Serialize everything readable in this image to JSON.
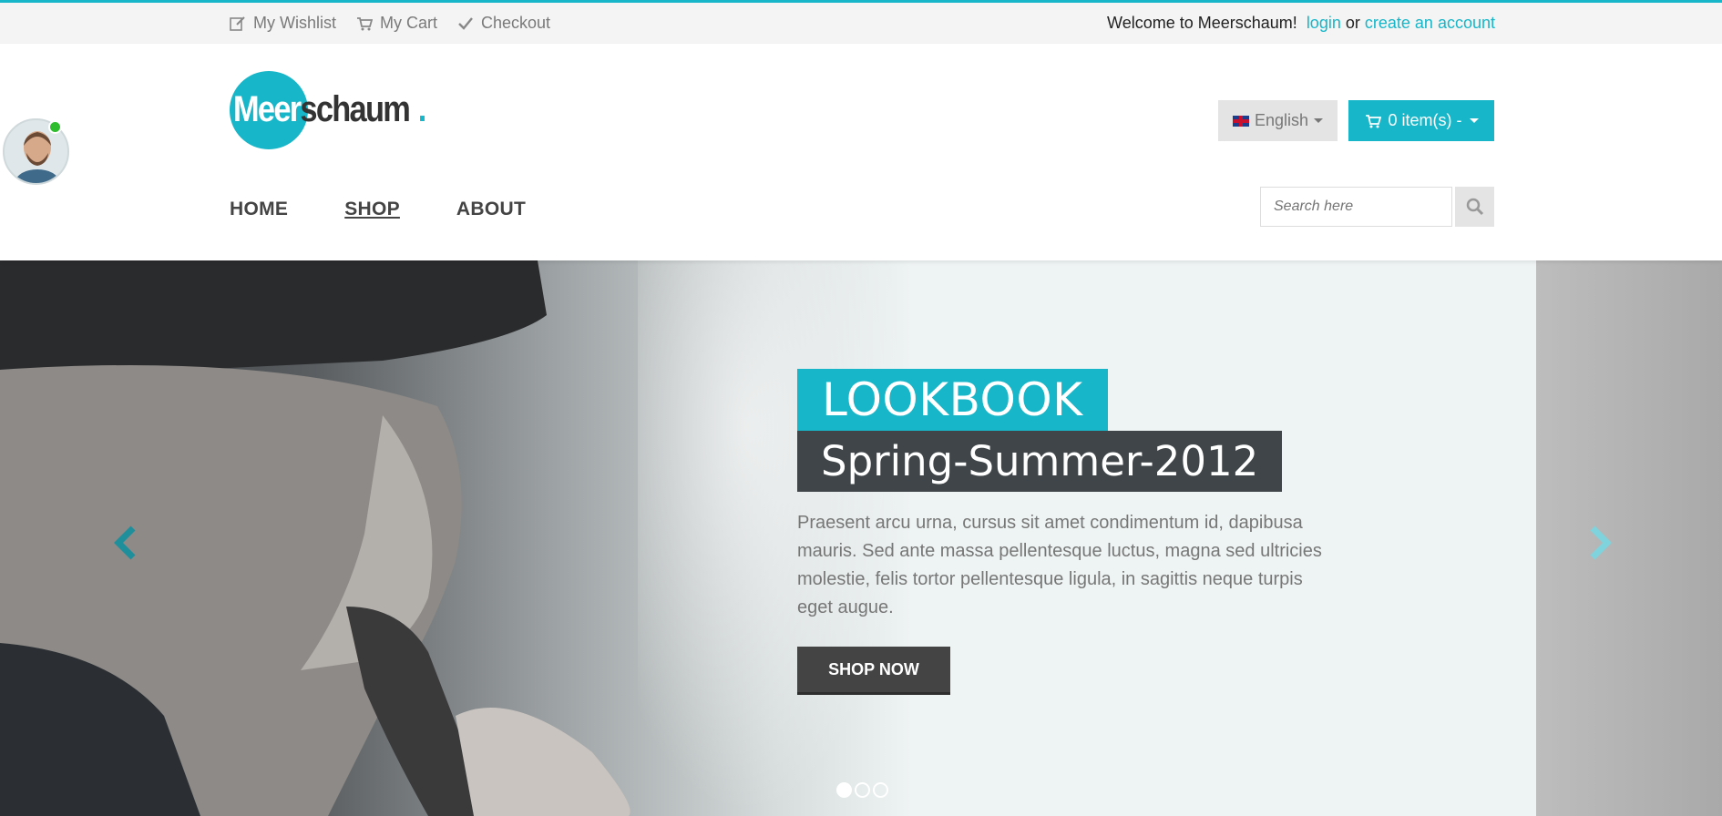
{
  "topbar": {
    "links": [
      {
        "label": "My Wishlist",
        "icon": "edit-icon"
      },
      {
        "label": "My Cart",
        "icon": "cart-icon"
      },
      {
        "label": "Checkout",
        "icon": "check-icon"
      }
    ],
    "welcome": "Welcome to Meerschaum!",
    "login": "login",
    "or": "or",
    "create_account": "create an account"
  },
  "logo": {
    "white_part": "Meer",
    "dark_part": "schaum",
    "dot": "."
  },
  "header": {
    "language": "English",
    "cart": "0 item(s) -",
    "search_placeholder": "Search here"
  },
  "nav": [
    {
      "label": "HOME",
      "active": false
    },
    {
      "label": "SHOP",
      "active": true
    },
    {
      "label": "ABOUT",
      "active": false
    }
  ],
  "slide": {
    "title1": "LOOKBOOK",
    "title2": "Spring-Summer-2012",
    "text": "Praesent arcu urna, cursus sit amet condimentum id, dapibusa mauris. Sed ante massa pellentesque luctus, magna sed ultricies molestie, felis tortor pellentesque ligula, in sagittis neque turpis eget augue.",
    "cta": "SHOP NOW",
    "dots_total": 3,
    "dot_active": 1
  },
  "colors": {
    "accent": "#17b6c8",
    "dark": "#3f4548"
  }
}
